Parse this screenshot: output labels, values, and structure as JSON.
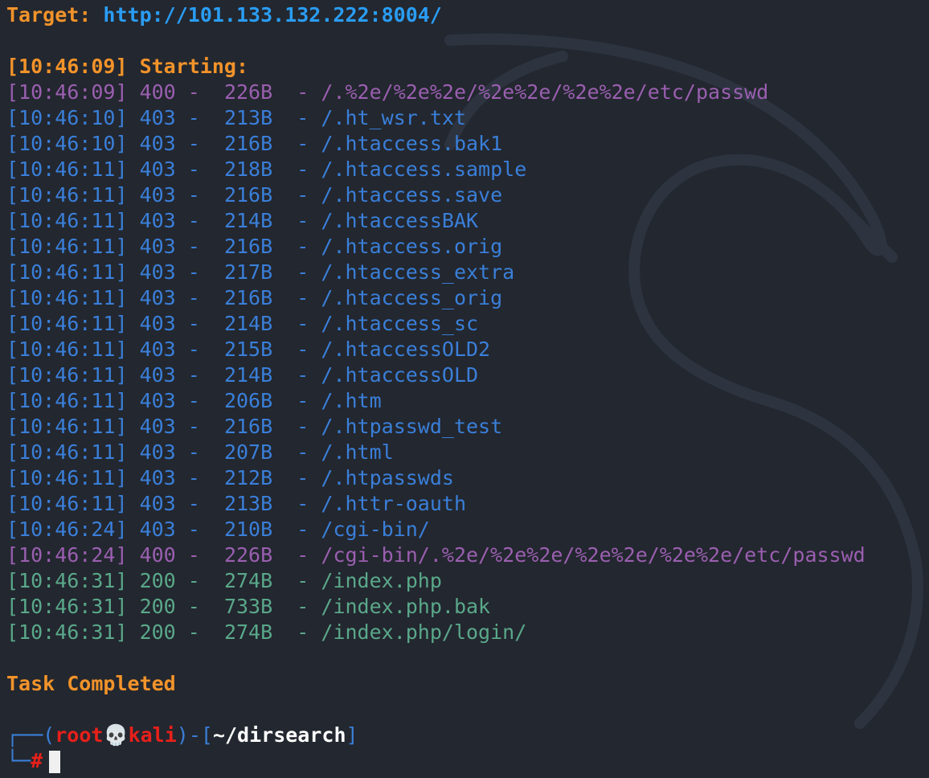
{
  "target": {
    "label": "Target:",
    "url": "http://101.133.132.222:8004/"
  },
  "start": {
    "timestamp": "[10:46:09]",
    "label": "Starting:"
  },
  "results": [
    {
      "time": "[10:46:09]",
      "status": "400",
      "size": "226B",
      "path": "/.%2e/%2e%2e/%2e%2e/%2e%2e/etc/passwd"
    },
    {
      "time": "[10:46:10]",
      "status": "403",
      "size": "213B",
      "path": "/.ht_wsr.txt"
    },
    {
      "time": "[10:46:10]",
      "status": "403",
      "size": "216B",
      "path": "/.htaccess.bak1"
    },
    {
      "time": "[10:46:11]",
      "status": "403",
      "size": "218B",
      "path": "/.htaccess.sample"
    },
    {
      "time": "[10:46:11]",
      "status": "403",
      "size": "216B",
      "path": "/.htaccess.save"
    },
    {
      "time": "[10:46:11]",
      "status": "403",
      "size": "214B",
      "path": "/.htaccessBAK"
    },
    {
      "time": "[10:46:11]",
      "status": "403",
      "size": "216B",
      "path": "/.htaccess.orig"
    },
    {
      "time": "[10:46:11]",
      "status": "403",
      "size": "217B",
      "path": "/.htaccess_extra"
    },
    {
      "time": "[10:46:11]",
      "status": "403",
      "size": "216B",
      "path": "/.htaccess_orig"
    },
    {
      "time": "[10:46:11]",
      "status": "403",
      "size": "214B",
      "path": "/.htaccess_sc"
    },
    {
      "time": "[10:46:11]",
      "status": "403",
      "size": "215B",
      "path": "/.htaccessOLD2"
    },
    {
      "time": "[10:46:11]",
      "status": "403",
      "size": "214B",
      "path": "/.htaccessOLD"
    },
    {
      "time": "[10:46:11]",
      "status": "403",
      "size": "206B",
      "path": "/.htm"
    },
    {
      "time": "[10:46:11]",
      "status": "403",
      "size": "216B",
      "path": "/.htpasswd_test"
    },
    {
      "time": "[10:46:11]",
      "status": "403",
      "size": "207B",
      "path": "/.html"
    },
    {
      "time": "[10:46:11]",
      "status": "403",
      "size": "212B",
      "path": "/.htpasswds"
    },
    {
      "time": "[10:46:11]",
      "status": "403",
      "size": "213B",
      "path": "/.httr-oauth"
    },
    {
      "time": "[10:46:24]",
      "status": "403",
      "size": "210B",
      "path": "/cgi-bin/"
    },
    {
      "time": "[10:46:24]",
      "status": "400",
      "size": "226B",
      "path": "/cgi-bin/.%2e/%2e%2e/%2e%2e/%2e%2e/etc/passwd"
    },
    {
      "time": "[10:46:31]",
      "status": "200",
      "size": "274B",
      "path": "/index.php"
    },
    {
      "time": "[10:46:31]",
      "status": "200",
      "size": "733B",
      "path": "/index.php.bak"
    },
    {
      "time": "[10:46:31]",
      "status": "200",
      "size": "274B",
      "path": "/index.php/login/"
    }
  ],
  "completed": "Task Completed",
  "prompt": {
    "user": "root",
    "skull": "💀",
    "host": "kali",
    "cwd": "~/dirsearch",
    "symbol": "#"
  },
  "colors": {
    "background": "#23272f",
    "orange": "#f2932a",
    "url": "#2a9df4",
    "status_400": "#9a5fb0",
    "status_403": "#3a7fd9",
    "status_200": "#5aa88a",
    "prompt_red": "#e8201a"
  }
}
